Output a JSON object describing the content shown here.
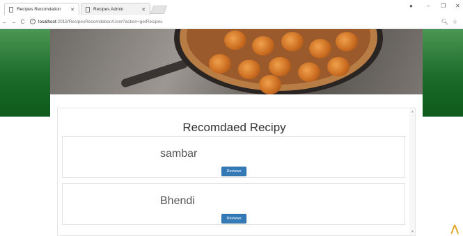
{
  "browser": {
    "tabs": [
      {
        "label": "Recipes Recomdation",
        "active": true
      },
      {
        "label": "Recipes Admin",
        "active": false
      }
    ],
    "url_host": "localhost",
    "url_path": ":2018/RecipesRecomdation/User?action=getRecipes"
  },
  "section": {
    "title": "Recomdaed Recipy"
  },
  "recipes": [
    {
      "name": "sambar",
      "button_label": "Reviews"
    },
    {
      "name": "Bhendi",
      "button_label": "Reviews"
    }
  ],
  "colors": {
    "green": "#1b6b2a",
    "button": "#337ab7"
  }
}
